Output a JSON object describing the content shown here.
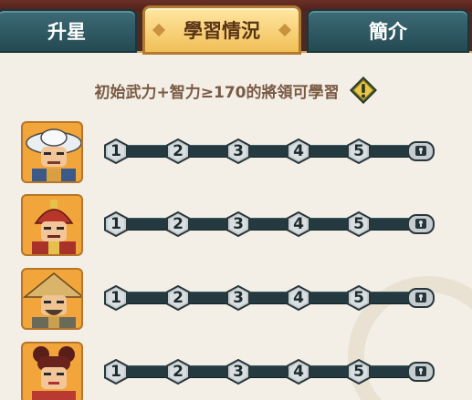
{
  "tabs": [
    {
      "label": "升星",
      "state": "inactive"
    },
    {
      "label": "學習情況",
      "state": "active"
    },
    {
      "label": "簡介",
      "state": "inactive"
    }
  ],
  "requirement": {
    "text": "初始武力+智力≥170的將領可學習",
    "icon": "exclamation-hint-icon"
  },
  "generals": [
    {
      "portrait": "general-portrait-white-hat",
      "stages": [
        "1",
        "2",
        "3",
        "4",
        "5"
      ],
      "final": "lock-chest-icon"
    },
    {
      "portrait": "general-portrait-red-helmet",
      "stages": [
        "1",
        "2",
        "3",
        "4",
        "5"
      ],
      "final": "lock-chest-icon"
    },
    {
      "portrait": "general-portrait-straw-hat",
      "stages": [
        "1",
        "2",
        "3",
        "4",
        "5"
      ],
      "final": "lock-chest-icon"
    },
    {
      "portrait": "general-portrait-red-hair",
      "stages": [
        "1",
        "2",
        "3",
        "4",
        "5"
      ],
      "final": "lock-chest-icon"
    }
  ],
  "colors": {
    "tab_dark": "#2f5a64",
    "tab_active": "#f6cf6a",
    "panel": "#f3efe6",
    "track": "#243a40",
    "node": "#c6cdd0",
    "title_text": "#7a5a45"
  }
}
